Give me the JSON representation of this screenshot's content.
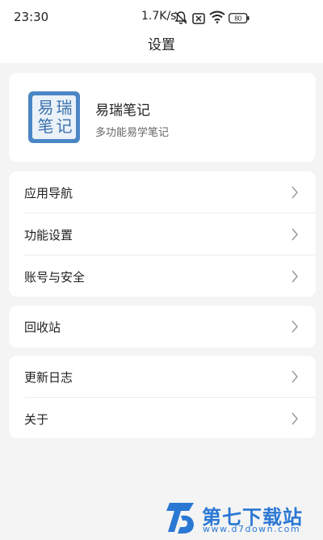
{
  "status_bar": {
    "time": "23:30",
    "speed": "1.7K/s",
    "battery": "80"
  },
  "header": {
    "title": "设置"
  },
  "app_card": {
    "name": "易瑞笔记",
    "description": "多功能易学笔记",
    "logo_chars": [
      "易",
      "瑞",
      "笔",
      "记"
    ]
  },
  "menu_groups": [
    {
      "items": [
        {
          "label": "应用导航"
        },
        {
          "label": "功能设置"
        },
        {
          "label": "账号与安全"
        }
      ]
    },
    {
      "items": [
        {
          "label": "回收站"
        }
      ]
    },
    {
      "items": [
        {
          "label": "更新日志"
        },
        {
          "label": "关于"
        }
      ]
    }
  ],
  "watermark": {
    "brand": "第七下载站",
    "url": "www.d7down.com"
  },
  "colors": {
    "background": "#f4f4f4",
    "card": "#ffffff",
    "logo_blue": "#4a86c5",
    "watermark_blue": "#2b78d4"
  }
}
